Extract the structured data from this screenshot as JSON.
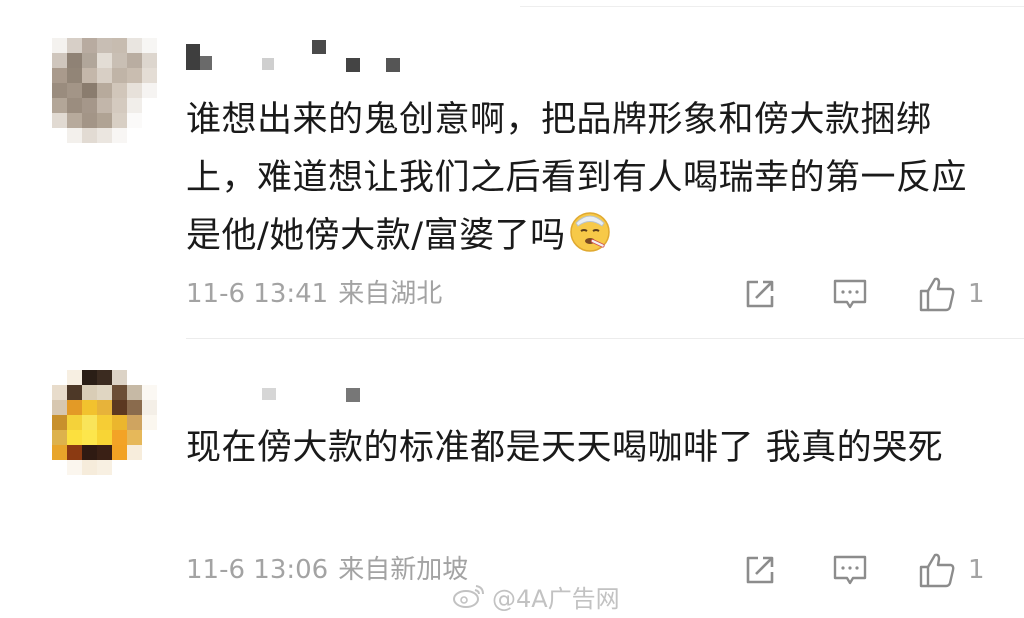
{
  "comments": [
    {
      "text": "谁想出来的鬼创意啊，把品牌形象和傍大款捆绑上，难道想让我们之后看到有人喝瑞幸的第一反应是他/她傍大款/富婆了吗",
      "emoji": "sick-face-emoji",
      "date": "11-6 13:41",
      "location": "来自湖北",
      "likes": "1"
    },
    {
      "text": "现在傍大款的标准都是天天喝咖啡了 我真的哭死",
      "date": "11-6 13:06",
      "location": "来自新加坡",
      "likes": "1"
    }
  ],
  "watermark": "@4A广告网",
  "icons": {
    "share": "share-icon",
    "reply": "comment-icon",
    "like": "thumbs-up-icon",
    "watermark_logo": "weibo-logo-icon"
  },
  "colors": {
    "text": "#1a1a1a",
    "meta": "#a3a3a3",
    "divider": "#ececec",
    "background": "#ffffff"
  }
}
